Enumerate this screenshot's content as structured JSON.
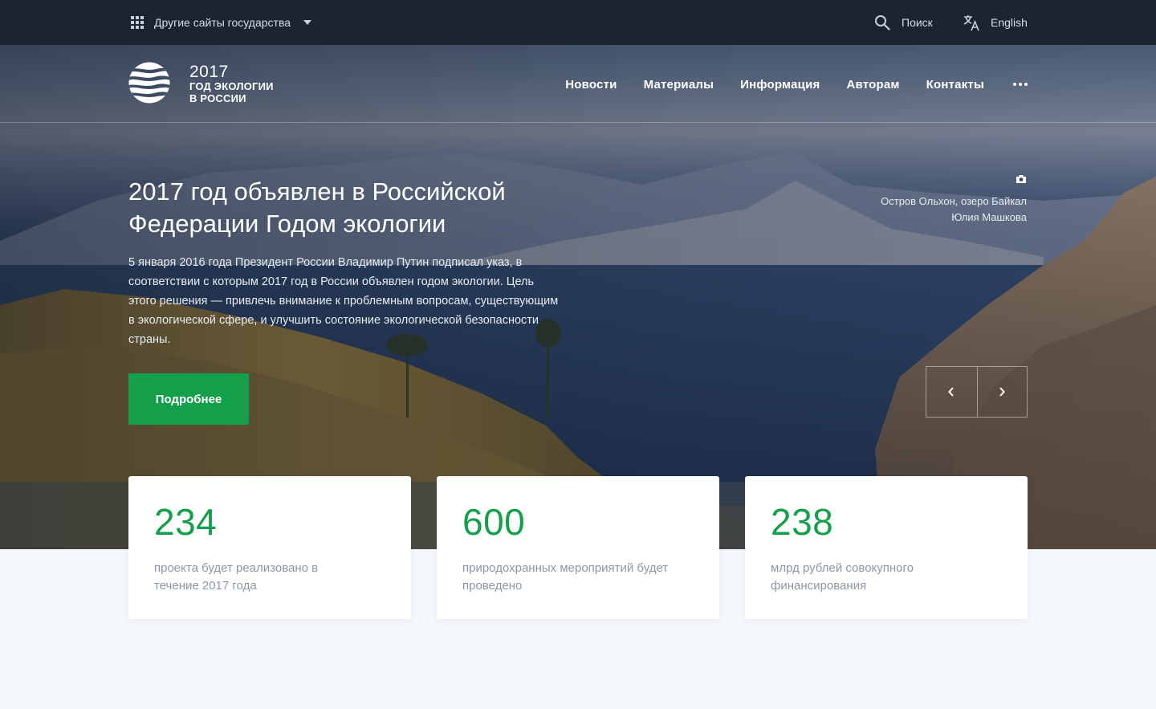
{
  "topbar": {
    "other_sites_label": "Другие сайты государства",
    "search_label": "Поиск",
    "language_label": "English"
  },
  "header": {
    "logo": {
      "year": "2017",
      "line1": "ГОД ЭКОЛОГИИ",
      "line2": "В РОССИИ"
    },
    "nav": [
      {
        "label": "Новости"
      },
      {
        "label": "Материалы"
      },
      {
        "label": "Информация"
      },
      {
        "label": "Авторам"
      },
      {
        "label": "Контакты"
      }
    ]
  },
  "hero": {
    "title": "2017 год объявлен в Российской Федерации Годом экологии",
    "text": "5 января 2016 года Президент России Владимир Путин подписал указ, в соответствии с которым 2017 год в России объявлен годом экологии. Цель этого решения — привлечь внимание к проблемным вопросам, существующим в экологической сфере, и улучшить состояние экологической безопасности страны.",
    "button_label": "Подробнее",
    "photo_place": "Остров Ольхон, озеро Байкал",
    "photo_author": "Юлия Машкова"
  },
  "stats": [
    {
      "value": "234",
      "description": "проекта будет реализовано в течение 2017 года"
    },
    {
      "value": "600",
      "description": "природохранных мероприятий будет проведено"
    },
    {
      "value": "238",
      "description": "млрд рублей совокупного финансирования"
    }
  ],
  "colors": {
    "accent": "#14a04a",
    "topbar_bg": "#1b2431",
    "page_bg": "#f4f7fb"
  }
}
